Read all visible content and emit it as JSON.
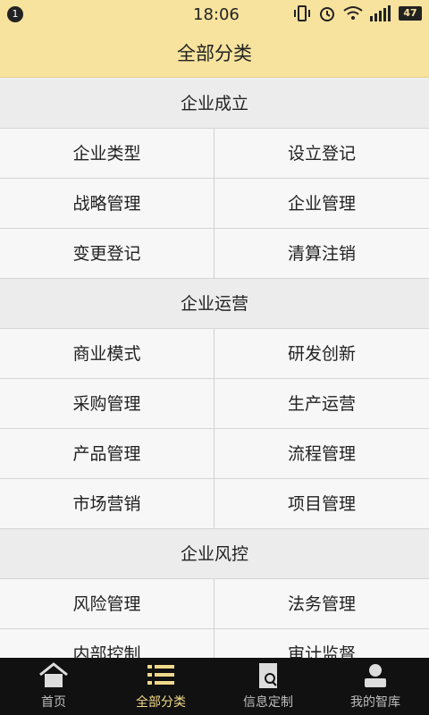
{
  "status_bar": {
    "time": "18:06",
    "notification_count": "1",
    "battery_level": "47"
  },
  "header": {
    "title": "全部分类"
  },
  "sections": [
    {
      "title": "企业成立",
      "items": [
        "企业类型",
        "设立登记",
        "战略管理",
        "企业管理",
        "变更登记",
        "清算注销"
      ]
    },
    {
      "title": "企业运营",
      "items": [
        "商业模式",
        "研发创新",
        "采购管理",
        "生产运营",
        "产品管理",
        "流程管理",
        "市场营销",
        "项目管理"
      ]
    },
    {
      "title": "企业风控",
      "items": [
        "风险管理",
        "法务管理",
        "内部控制",
        "审计监督"
      ]
    }
  ],
  "tabbar": {
    "items": [
      {
        "label": "首页",
        "icon": "home-icon"
      },
      {
        "label": "全部分类",
        "icon": "list-icon",
        "active": true
      },
      {
        "label": "信息定制",
        "icon": "document-search-icon"
      },
      {
        "label": "我的智库",
        "icon": "user-icon"
      }
    ]
  },
  "colors": {
    "header_bg": "#f7e39e",
    "tabbar_bg": "#111111",
    "active_tab": "#f2d98a"
  }
}
